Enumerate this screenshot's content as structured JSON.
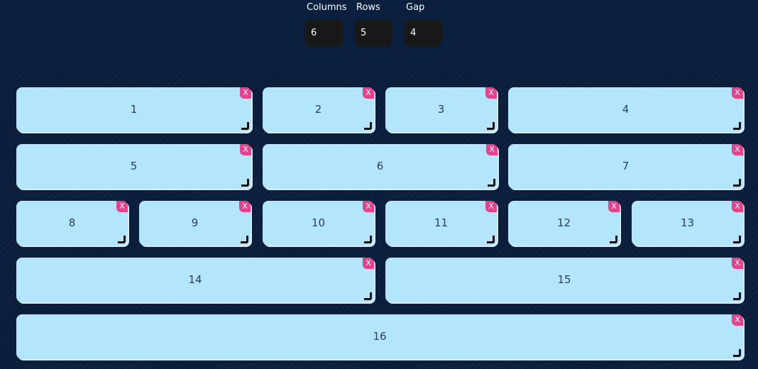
{
  "controls": {
    "columns": {
      "label": "Columns",
      "value": "6"
    },
    "rows": {
      "label": "Rows",
      "value": "5"
    },
    "gap": {
      "label": "Gap",
      "value": "4"
    }
  },
  "tiles": [
    {
      "label": "1",
      "close": "X"
    },
    {
      "label": "2",
      "close": "X"
    },
    {
      "label": "3",
      "close": "X"
    },
    {
      "label": "4",
      "close": "X"
    },
    {
      "label": "5",
      "close": "X"
    },
    {
      "label": "6",
      "close": "X"
    },
    {
      "label": "7",
      "close": "X"
    },
    {
      "label": "8",
      "close": "X"
    },
    {
      "label": "9",
      "close": "X"
    },
    {
      "label": "10",
      "close": "X"
    },
    {
      "label": "11",
      "close": "X"
    },
    {
      "label": "12",
      "close": "X"
    },
    {
      "label": "13",
      "close": "X"
    },
    {
      "label": "14",
      "close": "X"
    },
    {
      "label": "15",
      "close": "X"
    },
    {
      "label": "16",
      "close": "X"
    }
  ],
  "colors": {
    "background": "#0b1f3f",
    "tile": "#b3e5fc",
    "close_button": "#e8418c",
    "input_background": "#181818"
  }
}
